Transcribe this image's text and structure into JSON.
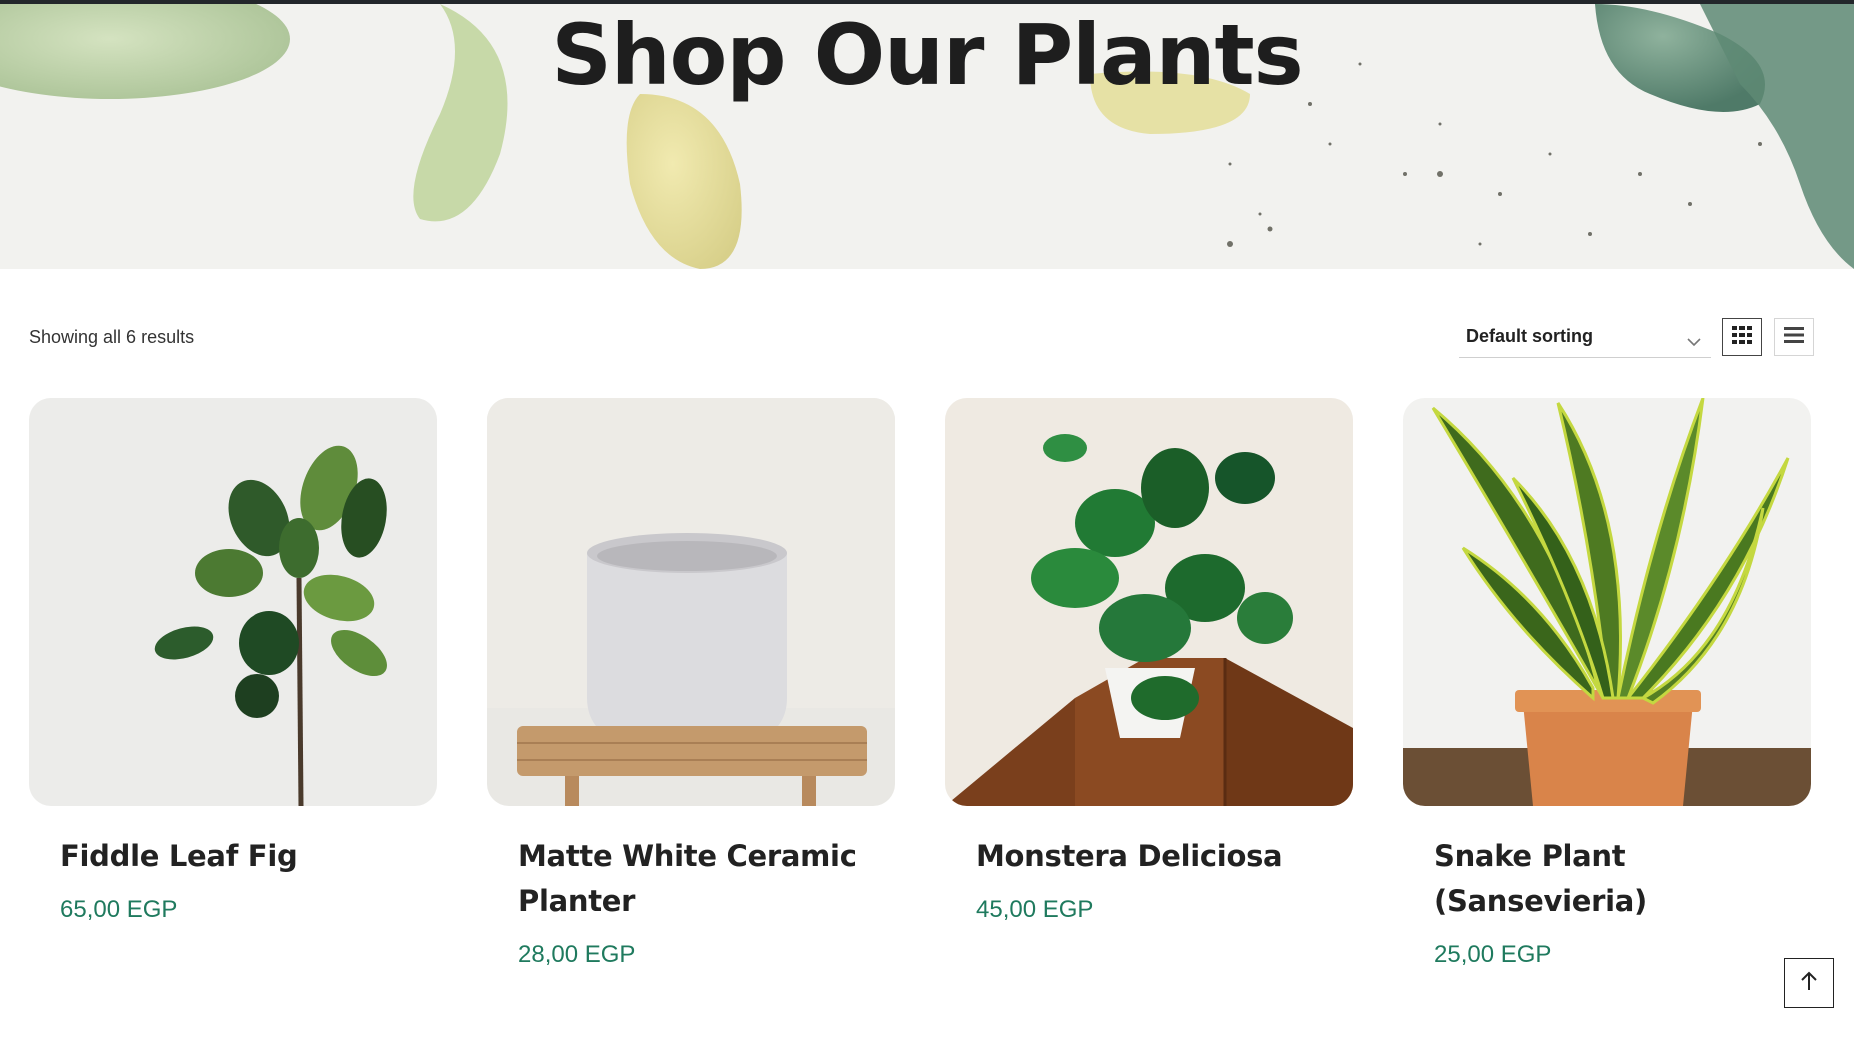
{
  "hero": {
    "title": "Shop Our Plants"
  },
  "toolbar": {
    "result_count": "Showing all 6 results",
    "sort_selected": "Default sorting",
    "grid_icon": "grid-view-icon",
    "list_icon": "list-view-icon"
  },
  "products": [
    {
      "name": "Fiddle Leaf Fig",
      "price": "65,00 EGP"
    },
    {
      "name": "Matte White Ceramic Planter",
      "price": "28,00 EGP"
    },
    {
      "name": "Monstera Deliciosa",
      "price": "45,00 EGP"
    },
    {
      "name": "Snake Plant (Sansevieria)",
      "price": "25,00 EGP"
    }
  ],
  "colors": {
    "price": "#1f7a5e",
    "topbar": "#23272b"
  },
  "back_to_top_icon": "arrow-up-icon"
}
